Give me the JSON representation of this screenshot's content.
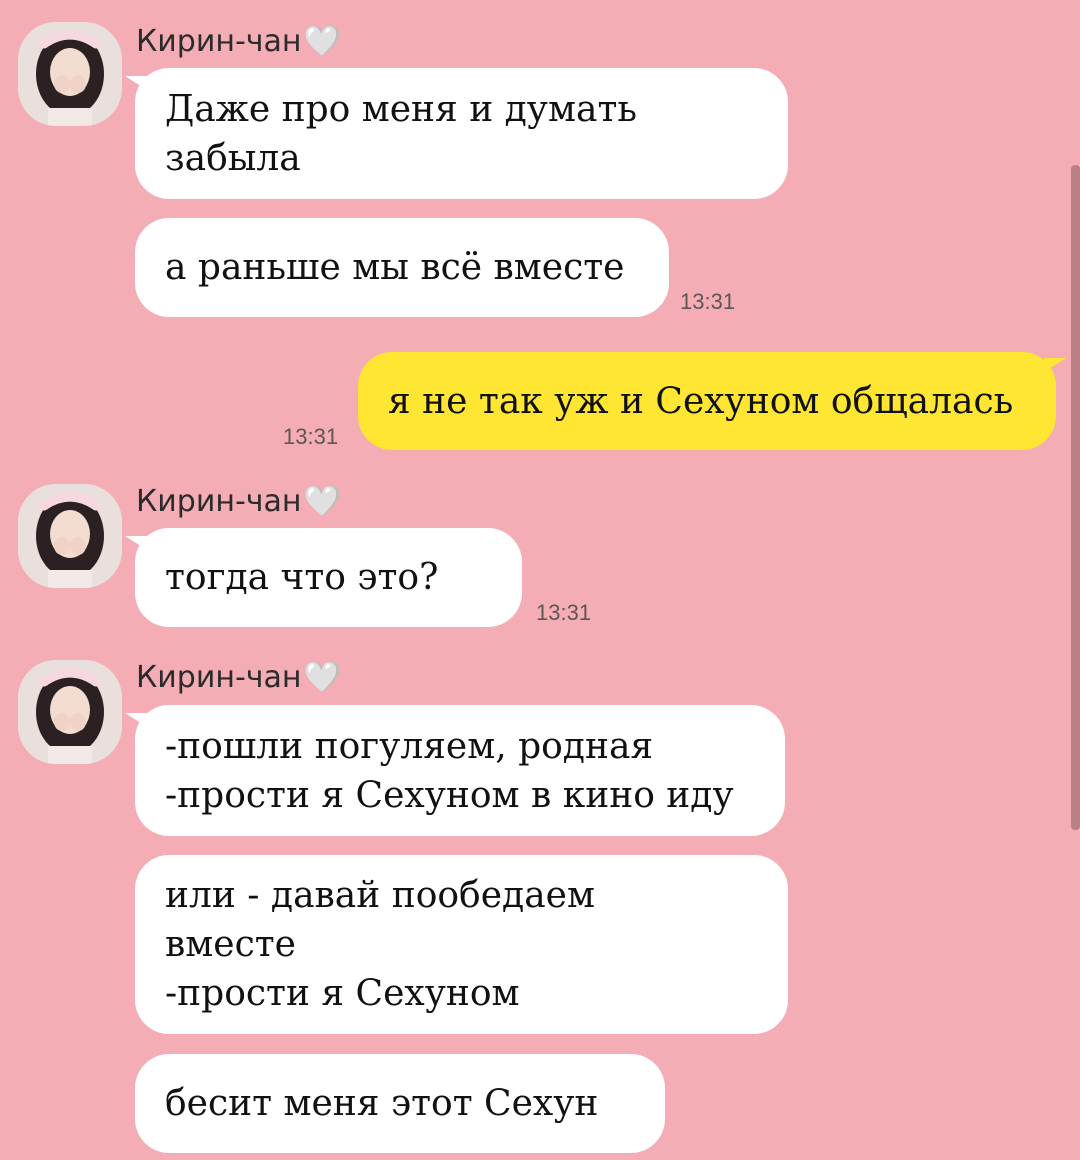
{
  "contact_name": "Кирин-чан",
  "heart": "🤍",
  "messages": [
    {
      "text": "Даже про меня и думать\nзабыла"
    },
    {
      "text": "а раньше мы всё вместе",
      "time": "13:31"
    },
    {
      "text": "я не так уж и Сехуном общалась",
      "time": "13:31"
    },
    {
      "text": "тогда что это?",
      "time": "13:31"
    },
    {
      "text": "-пошли погуляем, родная\n-прости я Сехуном в кино иду"
    },
    {
      "text": "или - давай пообедаем\nвместе\n-прости я Сехуном"
    },
    {
      "text": "бесит меня этот Сехун"
    }
  ],
  "icons": {
    "avatar": "profile-photo-girl"
  },
  "colors": {
    "background": "#f4adb4",
    "incoming_bubble": "#ffffff",
    "outgoing_bubble": "#ffe632",
    "timestamp": "#5f5557"
  }
}
